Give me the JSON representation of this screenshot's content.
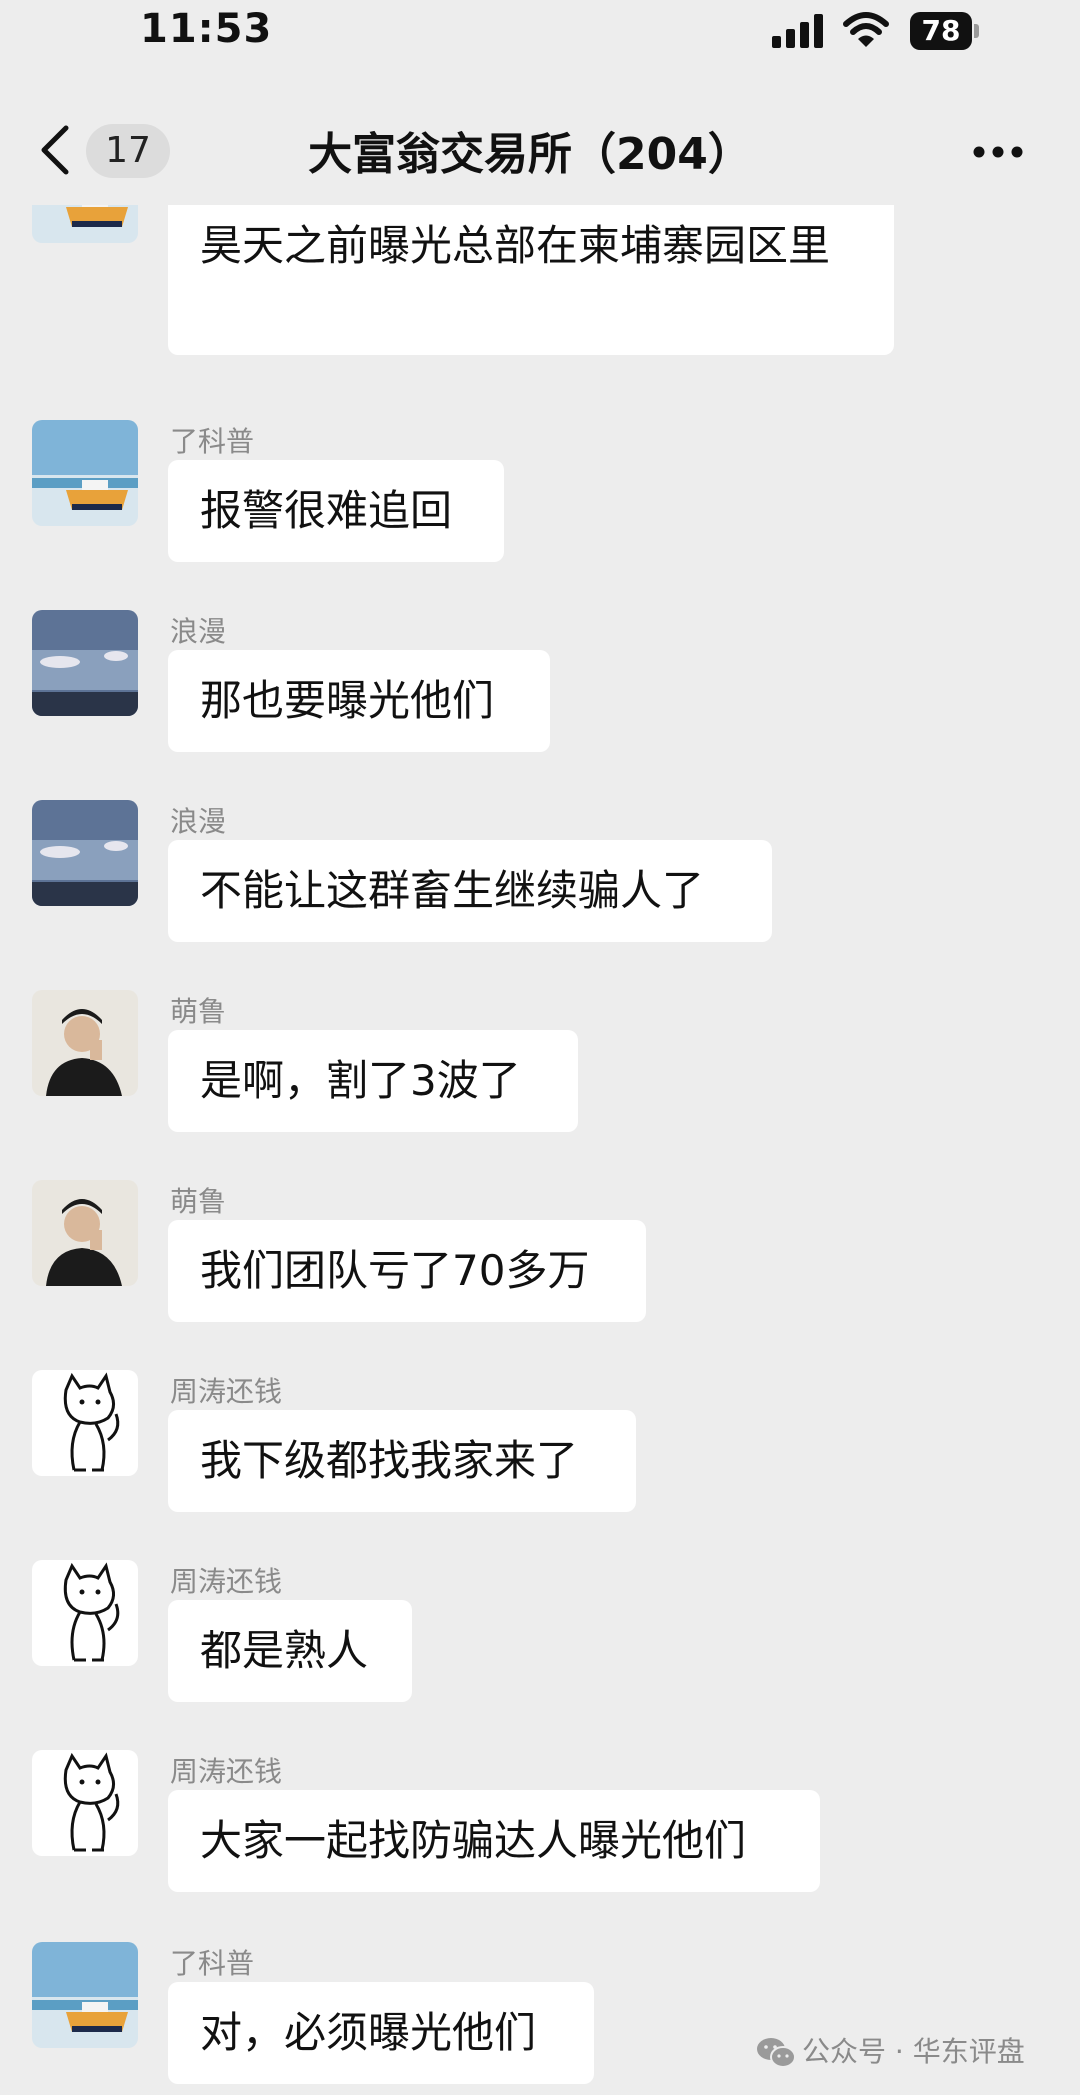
{
  "status_bar": {
    "time": "11:53",
    "battery": "78"
  },
  "header": {
    "back_count": "17",
    "title": "大富翁交易所（204）"
  },
  "messages": [
    {
      "sender": "",
      "avatar": "beach-boat-avatar",
      "text": "昊天之前曝光总部在柬埔寨园区里"
    },
    {
      "sender": "了科普",
      "avatar": "beach-boat-avatar",
      "text": "报警很难追回"
    },
    {
      "sender": "浪漫",
      "avatar": "sky-cloud-avatar",
      "text": "那也要曝光他们"
    },
    {
      "sender": "浪漫",
      "avatar": "sky-cloud-avatar",
      "text": "不能让这群畜生继续骗人了"
    },
    {
      "sender": "萌鲁",
      "avatar": "man-photo-avatar",
      "text": "是啊，割了3波了"
    },
    {
      "sender": "萌鲁",
      "avatar": "man-photo-avatar",
      "text": "我们团队亏了70多万"
    },
    {
      "sender": "周涛还钱",
      "avatar": "cat-sketch-avatar",
      "text": "我下级都找我家来了"
    },
    {
      "sender": "周涛还钱",
      "avatar": "cat-sketch-avatar",
      "text": "都是熟人"
    },
    {
      "sender": "周涛还钱",
      "avatar": "cat-sketch-avatar",
      "text": "大家一起找防骗达人曝光他们"
    },
    {
      "sender": "了科普",
      "avatar": "beach-boat-avatar",
      "text": "对，必须曝光他们"
    }
  ],
  "watermark": "公众号 · 华东评盘"
}
